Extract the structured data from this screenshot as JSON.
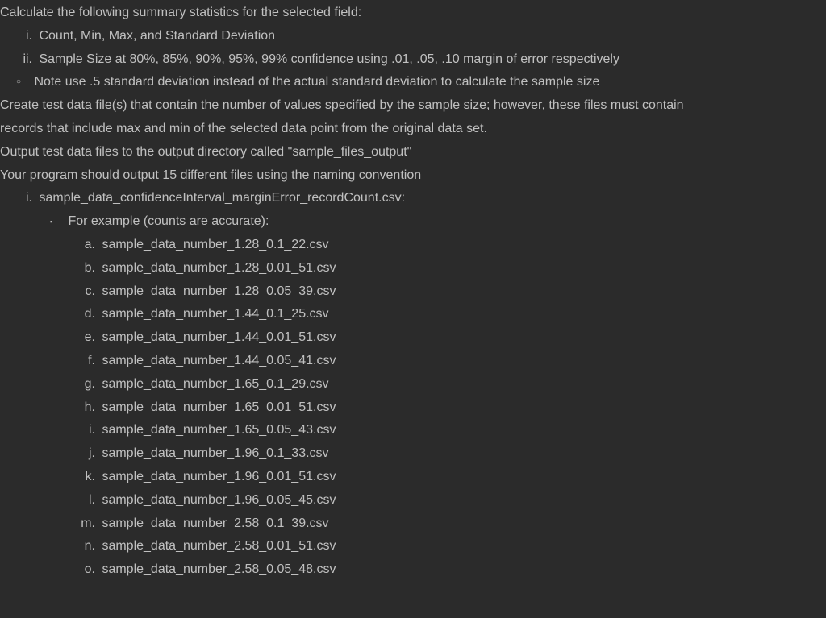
{
  "lines": {
    "l1": "Calculate the following summary statistics for the selected field:",
    "l2_marker": "i.",
    "l2": "Count, Min, Max, and Standard Deviation",
    "l3_marker": "ii.",
    "l3": "Sample Size at 80%, 85%, 90%, 95%, 99% confidence using .01, .05, .10 margin of error respectively",
    "l4_marker": "○",
    "l4": "Note use .5 standard deviation instead of the actual standard deviation to calculate the sample size",
    "l5": "Create test data file(s) that contain the number of values specified by the sample size; however, these files must contain",
    "l6": "records that include max and min of the selected data point from the original data set.",
    "l7": "Output test data files to the output directory called \"sample_files_output\"",
    "l8": "Your program should output 15 different files using the naming convention",
    "l9_marker": "i.",
    "l9": "sample_data_confidenceInterval_marginError_recordCount.csv:",
    "l10_marker": "▪",
    "l10": "For example (counts are accurate):",
    "fa_m": "a.",
    "fa": "sample_data_number_1.28_0.1_22.csv",
    "fb_m": "b.",
    "fb": "sample_data_number_1.28_0.01_51.csv",
    "fc_m": "c.",
    "fc": "sample_data_number_1.28_0.05_39.csv",
    "fd_m": "d.",
    "fd": "sample_data_number_1.44_0.1_25.csv",
    "fe_m": "e.",
    "fe": "sample_data_number_1.44_0.01_51.csv",
    "ff_m": "f.",
    "ff": "sample_data_number_1.44_0.05_41.csv",
    "fg_m": "g.",
    "fg": "sample_data_number_1.65_0.1_29.csv",
    "fh_m": "h.",
    "fh": "sample_data_number_1.65_0.01_51.csv",
    "fi_m": "i.",
    "fi": "sample_data_number_1.65_0.05_43.csv",
    "fj_m": "j.",
    "fj": "sample_data_number_1.96_0.1_33.csv",
    "fk_m": "k.",
    "fk": "sample_data_number_1.96_0.01_51.csv",
    "fl_m": "l.",
    "fl": "sample_data_number_1.96_0.05_45.csv",
    "fm_m": "m.",
    "fm": "sample_data_number_2.58_0.1_39.csv",
    "fn_m": "n.",
    "fn": "sample_data_number_2.58_0.01_51.csv",
    "fo_m": "o.",
    "fo": "sample_data_number_2.58_0.05_48.csv"
  }
}
